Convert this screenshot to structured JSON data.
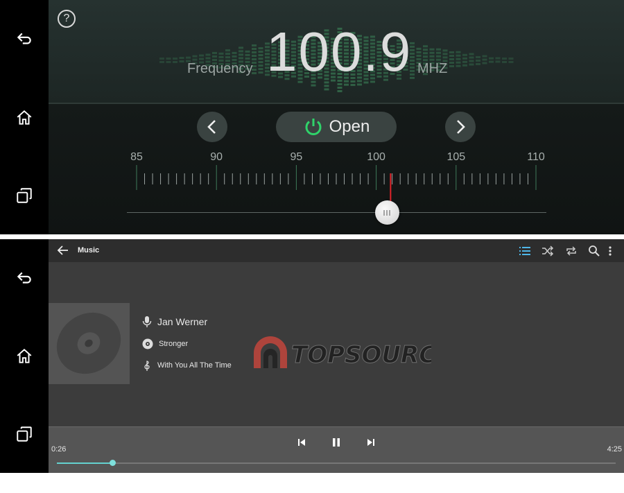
{
  "navbar": {
    "back_icon": "back-arrow-icon",
    "home_icon": "home-icon",
    "recents_icon": "recents-icon"
  },
  "radio": {
    "help_label": "?",
    "frequency_label": "Frequency",
    "frequency_value": "100.9",
    "frequency_unit": "MHZ",
    "open_label": "Open",
    "prev_icon": "chevron-left-icon",
    "next_icon": "chevron-right-icon",
    "power_icon": "power-icon",
    "scale_labels": [
      "85",
      "90",
      "95",
      "100",
      "105",
      "110"
    ],
    "scale_min": 85,
    "scale_max": 110,
    "current_frequency": 100.9,
    "slider_level": 0.62,
    "accent_color": "#2fd36a",
    "needle_color": "#e0242a"
  },
  "music": {
    "title": "Music",
    "back_icon": "back-arrow-icon",
    "toolbar_icons": [
      "playlist-icon",
      "shuffle-icon",
      "repeat-icon",
      "search-icon",
      "more-vert-icon"
    ],
    "artist": "Jan Werner",
    "album": "Stronger",
    "track": "With You All The Time",
    "watermark": "TOPSOURCE",
    "elapsed": "0:26",
    "duration": "4:25",
    "progress_fraction": 0.1,
    "accent_color": "#64d2d0"
  }
}
